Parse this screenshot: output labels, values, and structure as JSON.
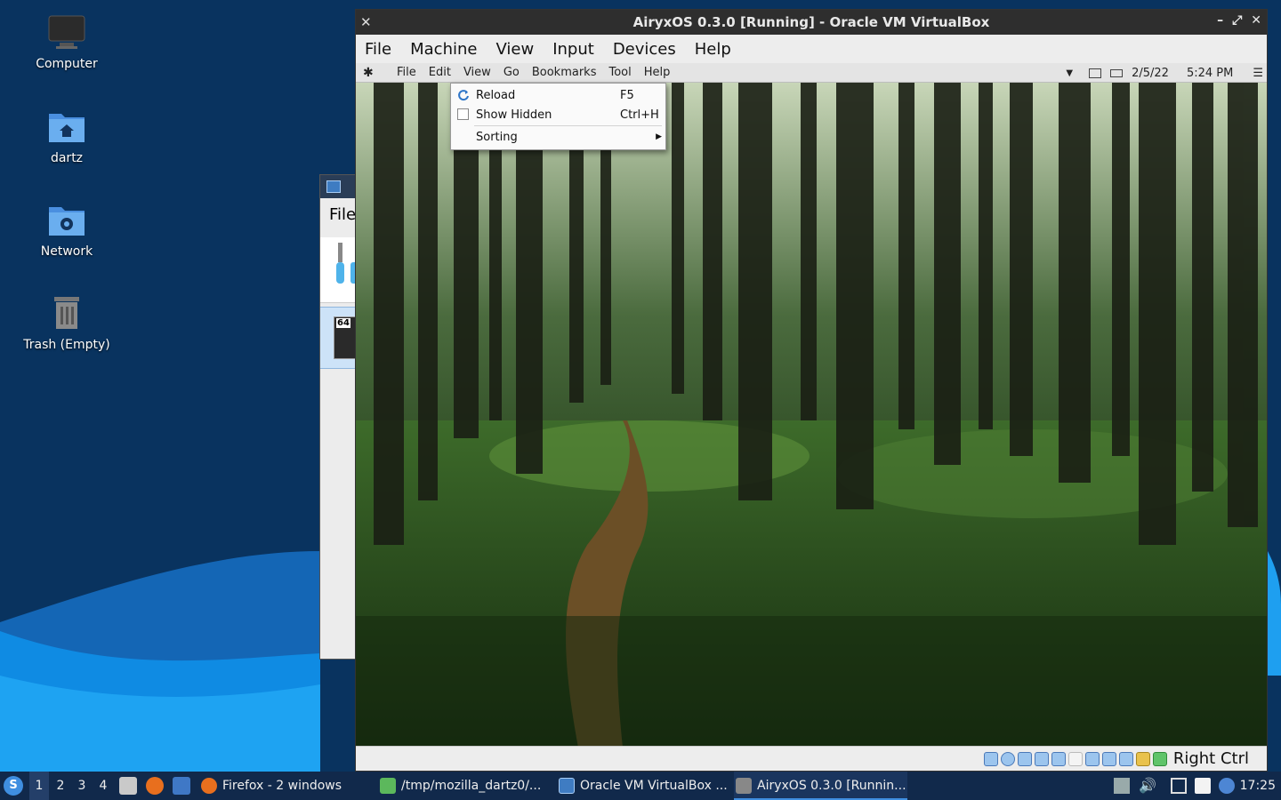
{
  "desktop": {
    "icons": [
      {
        "label": "Computer",
        "icon": "computer-icon"
      },
      {
        "label": "dartz",
        "icon": "home-folder-icon"
      },
      {
        "label": "Network",
        "icon": "network-folder-icon"
      },
      {
        "label": "Trash (Empty)",
        "icon": "trash-icon"
      }
    ]
  },
  "bg_window": {
    "menu_label": "File",
    "badge": "64"
  },
  "vm_window": {
    "title": "AiryxOS 0.3.0 [Running] - Oracle VM VirtualBox",
    "menu": [
      "File",
      "Machine",
      "View",
      "Input",
      "Devices",
      "Help"
    ],
    "host_key": "Right Ctrl"
  },
  "guest": {
    "menu": [
      "File",
      "Edit",
      "View",
      "Go",
      "Bookmarks",
      "Tool",
      "Help"
    ],
    "date": "2/5/22",
    "time": "5:24 PM",
    "view_menu": {
      "items": [
        {
          "label": "Reload",
          "shortcut": "F5",
          "icon": "reload-icon"
        },
        {
          "label": "Show Hidden",
          "shortcut": "Ctrl+H",
          "icon": "checkbox-icon",
          "checked": false
        },
        {
          "label": "Sorting",
          "shortcut": "",
          "submenu": true
        }
      ]
    }
  },
  "taskbar": {
    "workspaces": [
      "1",
      "2",
      "3",
      "4"
    ],
    "active_workspace": "1",
    "tasks": [
      {
        "label": "Firefox - 2 windows",
        "icon": "firefox-icon"
      },
      {
        "label": "/tmp/mozilla_dartz0/...",
        "icon": "file-icon"
      },
      {
        "label": "Oracle VM VirtualBox ...",
        "icon": "virtualbox-icon"
      },
      {
        "label": "AiryxOS 0.3.0 [Runnin...",
        "icon": "vm-icon",
        "active": true
      }
    ],
    "clock": "17:25"
  },
  "colors": {
    "desktop_bg": "#09335f",
    "wave_light": "#1e9ff0",
    "taskbar_bg": "#11294b",
    "accent": "#3f8ee0"
  }
}
